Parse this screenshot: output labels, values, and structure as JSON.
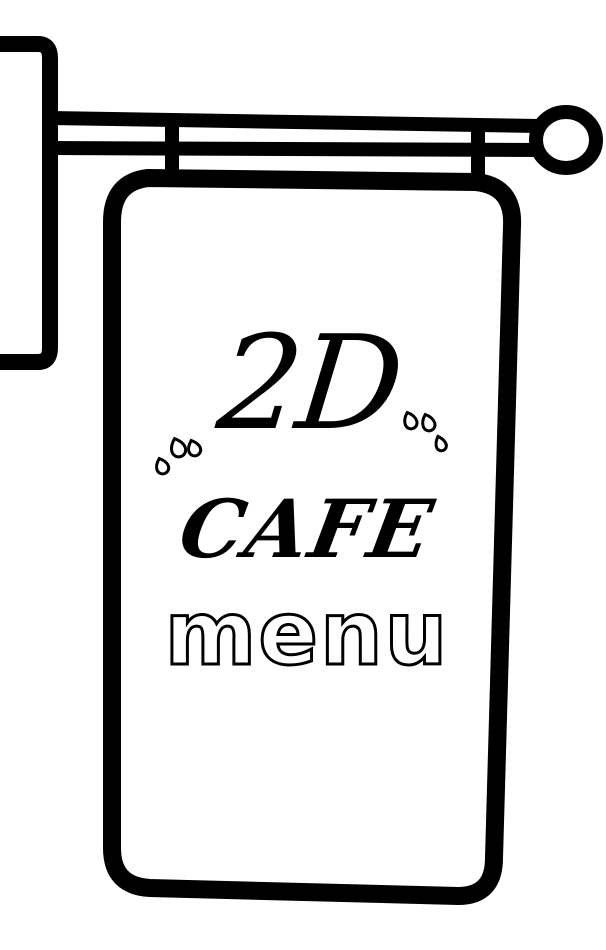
{
  "sign": {
    "line1": "2D",
    "line2": "CAFE",
    "line3": "menu"
  },
  "colors": {
    "ink": "#000000",
    "paper": "#ffffff"
  }
}
